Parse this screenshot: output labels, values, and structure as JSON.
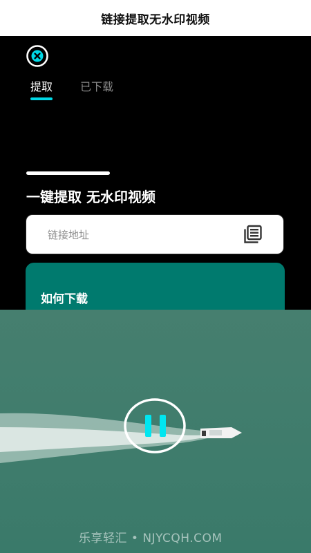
{
  "banner": {
    "title": "链接提取无水印视频"
  },
  "app": {
    "logo_icon": "close-circle-icon",
    "tabs": [
      {
        "label": "提取",
        "active": true
      },
      {
        "label": "已下载",
        "active": false
      }
    ],
    "headline": "一键提取 无水印视频",
    "url_input": {
      "placeholder": "链接地址",
      "icon": "paste-icon"
    },
    "howto": {
      "label": "如何下载"
    },
    "colors": {
      "accent": "#00d8e6",
      "card": "#007a6e",
      "water": "#3e7f6e"
    }
  },
  "video": {
    "control_icon": "pause-icon",
    "watermark": "乐享轻汇 • NJYCQH.COM"
  }
}
